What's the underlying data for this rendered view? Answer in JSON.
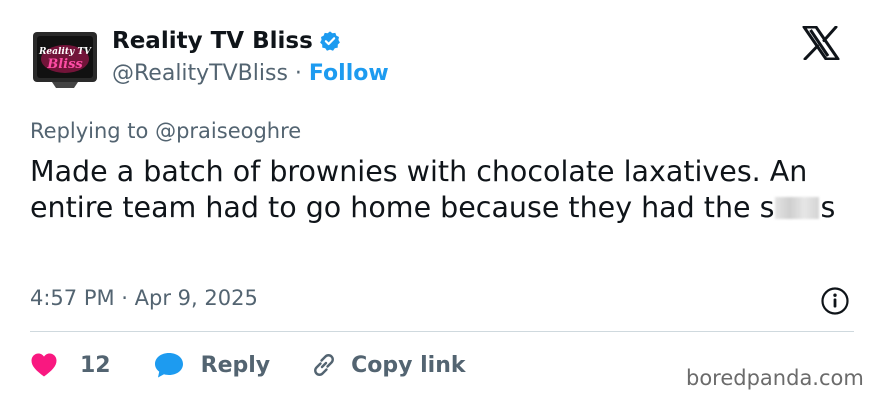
{
  "account": {
    "name": "Reality TV Bliss",
    "handle": "@RealityTVBliss",
    "separator": "·",
    "follow_label": "Follow",
    "avatar_text_1": "Reality TV",
    "avatar_text_2": "Bliss",
    "verified_icon": "verified-badge-icon"
  },
  "tweet": {
    "replying_prefix": "Replying to",
    "replying_handle": "@praiseoghre",
    "text_part1": "Made a batch of brownies with chocolate laxatives. An entire team had to go home because they had the s",
    "text_part2": "s",
    "timestamp": "4:57 PM · Apr 9, 2025"
  },
  "actions": {
    "like_count": "12",
    "reply_label": "Reply",
    "copy_label": "Copy link"
  },
  "watermark": "boredpanda.com",
  "colors": {
    "accent": "#1d9bf0",
    "like": "#f91880",
    "text": "#0f1419",
    "muted": "#536471"
  }
}
